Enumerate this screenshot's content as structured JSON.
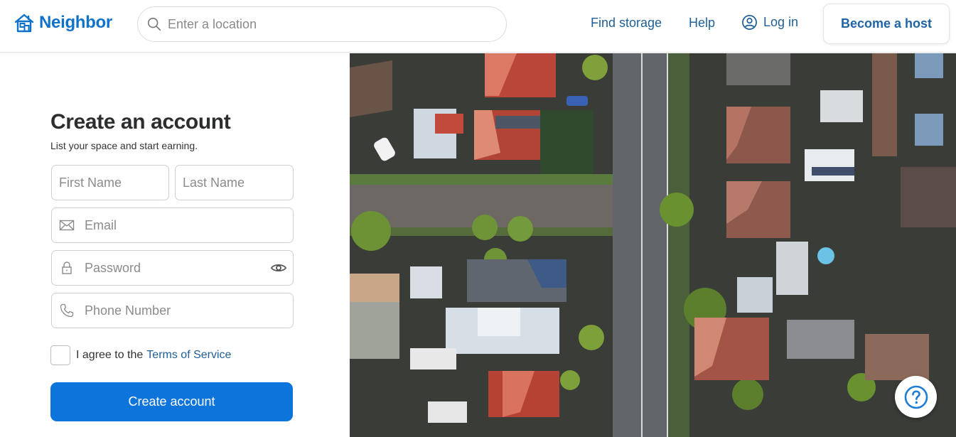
{
  "header": {
    "brand": "Neighbor",
    "search_placeholder": "Enter a location",
    "nav": {
      "find_storage": "Find storage",
      "help": "Help",
      "login": "Log in",
      "become_host": "Become a host"
    }
  },
  "form": {
    "title": "Create an account",
    "subtitle": "List your space and start earning.",
    "fields": {
      "first_name": {
        "placeholder": "First Name",
        "value": ""
      },
      "last_name": {
        "placeholder": "Last Name",
        "value": ""
      },
      "email": {
        "placeholder": "Email",
        "value": ""
      },
      "password": {
        "placeholder": "Password",
        "value": ""
      },
      "phone": {
        "placeholder": "Phone Number",
        "value": ""
      }
    },
    "agree_text": "I agree to the",
    "tos_link": "Terms of Service",
    "terms_checked": false,
    "submit_label": "Create account"
  },
  "hero": {
    "image_description": "Aerial view of suburban houses and streets"
  },
  "colors": {
    "brand_blue": "#0f72c9",
    "button_blue": "#0d74dc",
    "link_blue": "#1f5f96"
  }
}
